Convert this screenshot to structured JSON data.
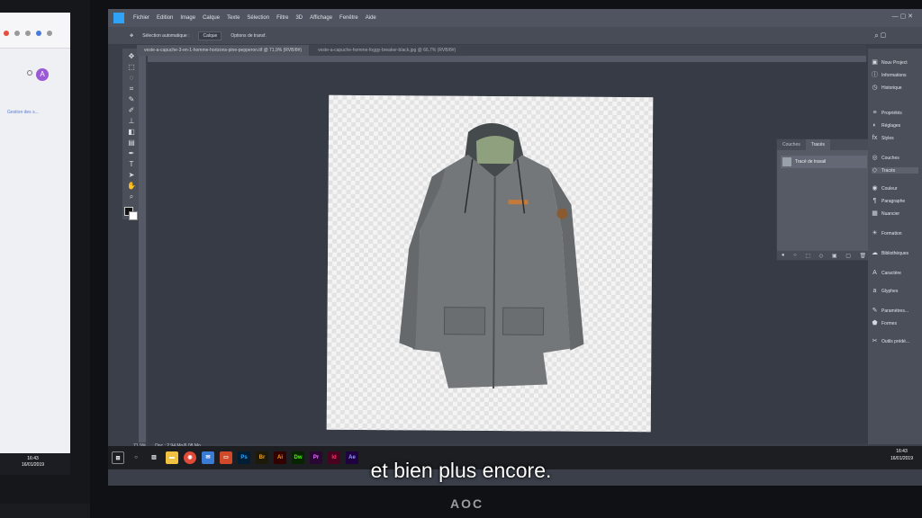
{
  "left_monitor": {
    "avatar_letter": "A",
    "link_text": "Gestion des s...",
    "clock_time": "16:43",
    "clock_date": "16/01/2019"
  },
  "photoshop": {
    "menu": [
      "Fichier",
      "Edition",
      "Image",
      "Calque",
      "Texte",
      "Sélection",
      "Filtre",
      "3D",
      "Affichage",
      "Fenêtre",
      "Aide"
    ],
    "options": {
      "auto_select": "Sélection automatique :",
      "layer_select": "Calque",
      "transform": "Options de transf."
    },
    "tabs": [
      "veste-a-capuche-3-en-1-homme-horizons-pine-pepperon.tif @ 71,9% (RVB/8#)",
      "veste-a-capuche-homme-foggy-breaker-black.jpg @ 66,7% (RVB/8#)"
    ],
    "status": {
      "zoom": "71,9%",
      "doc": "Doc : 2,94 Mo/6,08 Mo"
    },
    "panels": [
      "Nouv Project",
      "Informations",
      "Historique",
      "Propriétés",
      "Réglages",
      "Styles",
      "Couches",
      "Tracés",
      "Couleur",
      "Paragraphe",
      "Nuancier",
      "Formation",
      "Bibliothèques",
      "Caractère",
      "Glyphes",
      "Paramètres...",
      "Formes",
      "Outils prédé..."
    ],
    "traces_panel": {
      "tabs": [
        "Couches",
        "Tracés"
      ],
      "item": "Tracé de travail"
    }
  },
  "taskbar": {
    "apps": [
      "Ps",
      "Br",
      "Ai",
      "Dw",
      "Pr",
      "Id",
      "Ae"
    ],
    "clock_time": "16:43",
    "clock_date": "16/01/2019"
  },
  "monitor_brand": "AOC",
  "subtitle": "et bien plus encore.",
  "colors": {
    "photoshop_blue": "#2fa3f7",
    "panel_bg": "#4a4f5a",
    "canvas_bg": "#363b46"
  }
}
